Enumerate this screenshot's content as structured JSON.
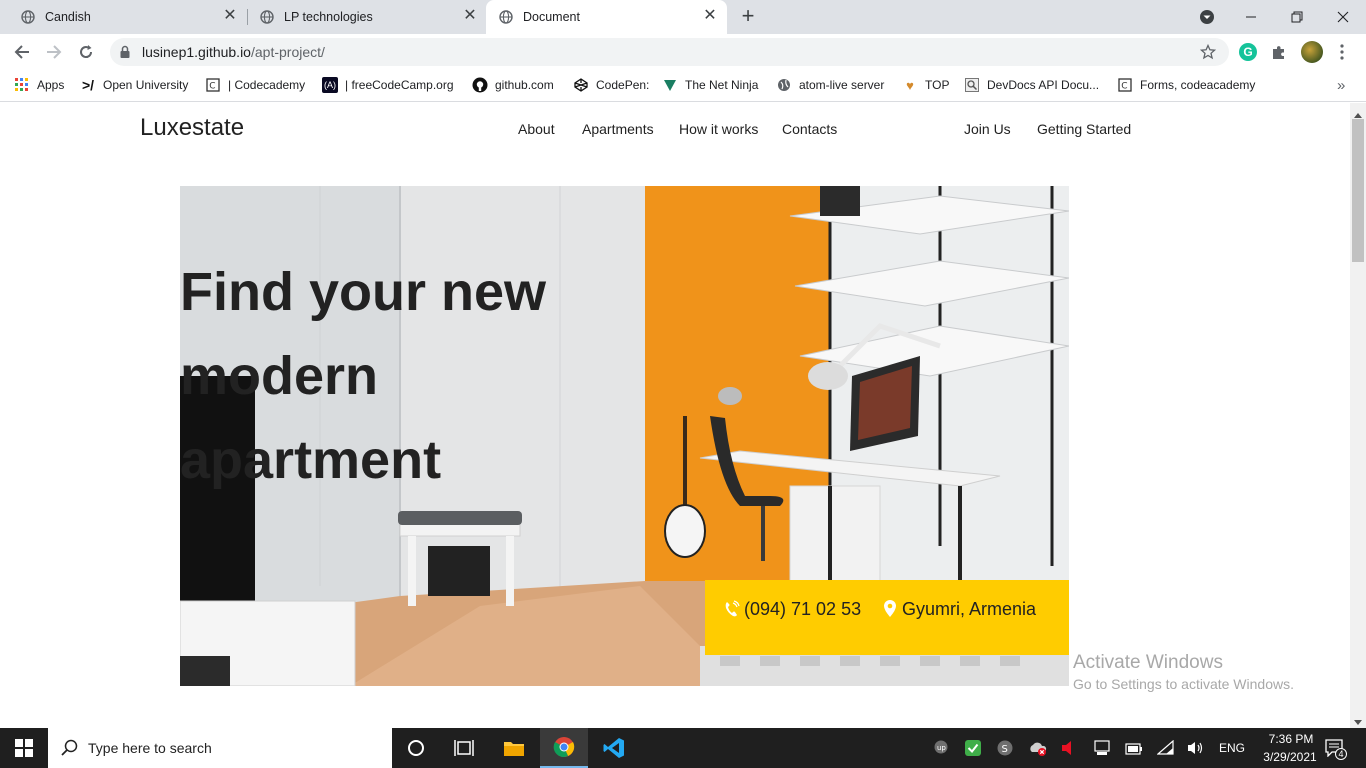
{
  "browser": {
    "tabs": [
      {
        "title": "Candish"
      },
      {
        "title": "LP technologies"
      },
      {
        "title": "Document"
      }
    ],
    "url_host": "lusinep1.github.io",
    "url_path": "/apt-project/",
    "bookmarks": [
      {
        "label": "Apps",
        "icon": "apps-grid-icon"
      },
      {
        "label": "Open University",
        "icon": "open-university-icon"
      },
      {
        "label": "| Codecademy",
        "icon": "codecademy-icon"
      },
      {
        "label": "| freeCodeCamp.org",
        "icon": "freecodecamp-icon"
      },
      {
        "label": "github.com",
        "icon": "github-icon"
      },
      {
        "label": "CodePen:",
        "icon": "codepen-icon"
      },
      {
        "label": "The Net Ninja",
        "icon": "net-ninja-icon"
      },
      {
        "label": "atom-live server",
        "icon": "globe-icon"
      },
      {
        "label": "TOP",
        "icon": "top-icon"
      },
      {
        "label": "DevDocs API Docu...",
        "icon": "devdocs-icon"
      },
      {
        "label": "Forms, codeacademy",
        "icon": "codecademy-icon"
      }
    ],
    "overflow_label": "»"
  },
  "site": {
    "brand": "Luxestate",
    "nav": [
      "About",
      "Apartments",
      "How it works",
      "Contacts"
    ],
    "nav_right": [
      "Join Us",
      "Getting Started"
    ],
    "hero_title_line1": "Find your new",
    "hero_title_line2": "modern apartment",
    "phone": "(094) 71 02 53",
    "location": "Gyumri, Armenia",
    "accent_color": "#ffcc00",
    "wall_orange": "#f0931a"
  },
  "watermark": {
    "line1": "Activate Windows",
    "line2": "Go to Settings to activate Windows."
  },
  "taskbar": {
    "search_placeholder": "Type here to search",
    "lang": "ENG",
    "time": "7:36 PM",
    "date": "3/29/2021",
    "notification_count": "4"
  }
}
